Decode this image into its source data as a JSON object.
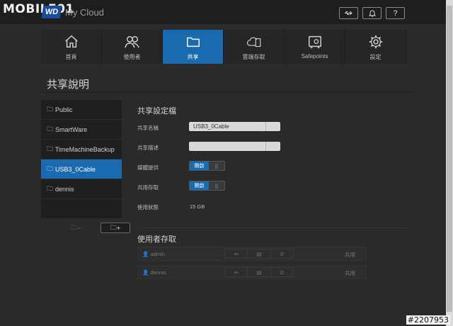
{
  "watermark": {
    "logo": "MOBILE01",
    "id": "#2207953"
  },
  "header": {
    "brand_badge": "WD",
    "product": "My Cloud",
    "icons": [
      "usb-icon",
      "bell-icon",
      "help-icon"
    ],
    "help_label": "?"
  },
  "nav": {
    "items": [
      {
        "label": "首頁",
        "icon": "home-icon"
      },
      {
        "label": "使用者",
        "icon": "users-icon"
      },
      {
        "label": "共享",
        "icon": "folder-icon",
        "active": true
      },
      {
        "label": "雲端存取",
        "icon": "cloud-device-icon"
      },
      {
        "label": "Safepoints",
        "icon": "safe-icon"
      },
      {
        "label": "設定",
        "icon": "gear-icon"
      }
    ]
  },
  "page": {
    "title": "共享說明"
  },
  "shares": {
    "items": [
      "Public",
      "SmartWare",
      "TimeMachineBackup",
      "USB3_0Cable",
      "dennis"
    ],
    "selected": "USB3_0Cable",
    "remove_label": "−",
    "add_label": "+"
  },
  "profile": {
    "title": "共享設定檔",
    "name_label": "共享名稱",
    "name_value": "USB3_0Cable",
    "desc_label": "共享描述",
    "desc_value": "",
    "media_label": "媒體提供",
    "media_state": "開啟",
    "public_label": "共用存取",
    "public_state": "開啟",
    "usage_label": "使用狀態",
    "usage_value": "15 GB"
  },
  "access": {
    "title": "使用者存取",
    "rows": [
      {
        "user": "admin",
        "state": "共用"
      },
      {
        "user": "dennis",
        "state": "共用"
      }
    ]
  },
  "colors": {
    "accent": "#1a6ab0",
    "background": "#2a2a2a"
  }
}
